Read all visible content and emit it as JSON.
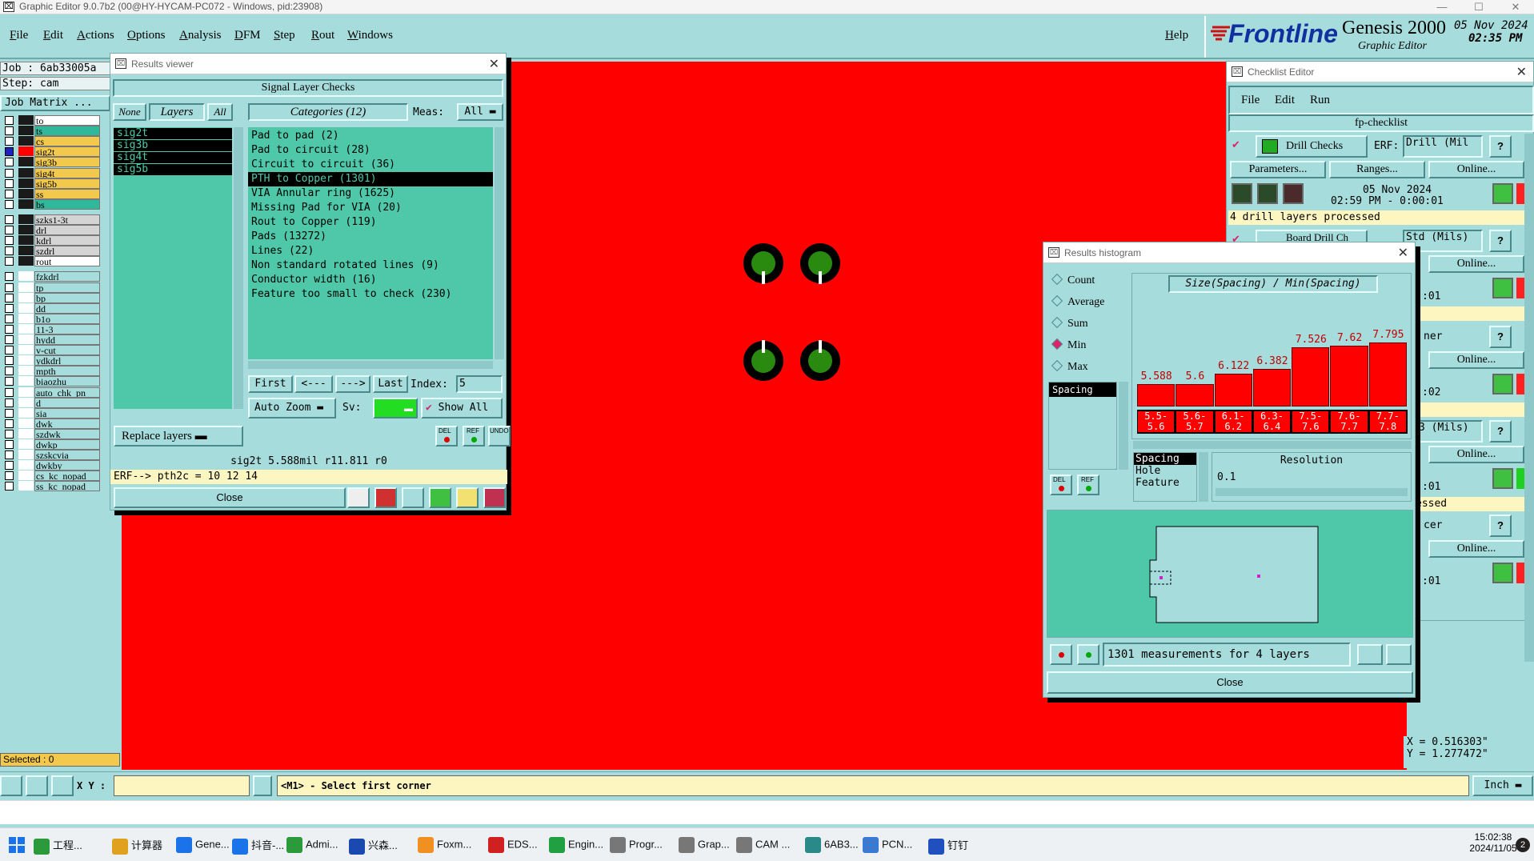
{
  "window": {
    "title": "Graphic Editor 9.0.7b2 (00@HY-HYCAM-PC072 - Windows, pid:23908)"
  },
  "menubar": {
    "items": [
      "File",
      "Edit",
      "Actions",
      "Options",
      "Analysis",
      "DFM",
      "Step",
      "Rout",
      "Windows"
    ],
    "help": "Help"
  },
  "brand": {
    "logo": "Frontline",
    "product": "Genesis 2000",
    "subtitle": "Graphic Editor",
    "date": "05 Nov 2024",
    "time": "02:35 PM"
  },
  "left_panel": {
    "job": "Job : 6ab33005a",
    "step": "Step: cam",
    "matrix_button": "Job Matrix ...",
    "layers": [
      {
        "name": "to",
        "color": "#ffffff"
      },
      {
        "name": "ts",
        "color": "#2fb89a"
      },
      {
        "name": "cs",
        "color": "#f2c94c"
      },
      {
        "name": "sig2t",
        "color": "#f2c94c",
        "active": true
      },
      {
        "name": "sig3b",
        "color": "#f2c94c"
      },
      {
        "name": "sig4t",
        "color": "#f2c94c"
      },
      {
        "name": "sig5b",
        "color": "#f2c94c"
      },
      {
        "name": "ss",
        "color": "#f2c94c"
      },
      {
        "name": "bs",
        "color": "#2fb89a"
      },
      {
        "name": "szks1-3t",
        "color": "#d4d4d4"
      },
      {
        "name": "drl",
        "color": "#d4d4d4"
      },
      {
        "name": "kdrl",
        "color": "#d4d4d4"
      },
      {
        "name": "szdrl",
        "color": "#d4d4d4"
      },
      {
        "name": "rout",
        "color": "#ffffff"
      },
      {
        "name": "fzkdrl",
        "color": "#a6dcdc"
      },
      {
        "name": "tp",
        "color": "#a6dcdc"
      },
      {
        "name": "bp",
        "color": "#a6dcdc"
      },
      {
        "name": "dd",
        "color": "#a6dcdc"
      },
      {
        "name": "b1o",
        "color": "#a6dcdc"
      },
      {
        "name": "11-3",
        "color": "#a6dcdc"
      },
      {
        "name": "hydd",
        "color": "#a6dcdc"
      },
      {
        "name": "v-cut",
        "color": "#a6dcdc"
      },
      {
        "name": "ydkdrl",
        "color": "#a6dcdc"
      },
      {
        "name": "mpth",
        "color": "#a6dcdc"
      },
      {
        "name": "biaozhu",
        "color": "#a6dcdc"
      },
      {
        "name": "auto_chk_pn",
        "color": "#a6dcdc"
      },
      {
        "name": "d",
        "color": "#a6dcdc"
      },
      {
        "name": "sia",
        "color": "#a6dcdc"
      },
      {
        "name": "dwk",
        "color": "#a6dcdc"
      },
      {
        "name": "szdwk",
        "color": "#a6dcdc"
      },
      {
        "name": "dwkp",
        "color": "#a6dcdc"
      },
      {
        "name": "szskcvia",
        "color": "#a6dcdc"
      },
      {
        "name": "dwkby",
        "color": "#a6dcdc"
      },
      {
        "name": "cs_kc_nopad",
        "color": "#a6dcdc"
      },
      {
        "name": "ss_kc_nopad",
        "color": "#a6dcdc"
      }
    ],
    "selected": "Selected : 0"
  },
  "results_viewer": {
    "title": "Results viewer",
    "header": "Signal Layer Checks",
    "none_btn": "None",
    "layers_label": "Layers",
    "all_btn": "All",
    "categories_label": "Categories (12)",
    "meas_label": "Meas:",
    "meas_value": "All",
    "layers": [
      "sig2t",
      "sig3b",
      "sig4t",
      "sig5b"
    ],
    "categories": [
      "Pad to pad (2)",
      "Pad to circuit (28)",
      "Circuit to circuit (36)",
      "PTH to Copper (1301)",
      "VIA Annular ring (1625)",
      "Missing Pad for VIA (20)",
      "Rout to Copper (119)",
      "Pads (13272)",
      "Lines (22)",
      "Non standard rotated lines (9)",
      "Conductor width (16)",
      "Feature too small to check (230)"
    ],
    "selected_category": 3,
    "first_btn": "First",
    "prev_btn": "<---",
    "next_btn": "--->",
    "last_btn": "Last",
    "index_label": "Index:",
    "index_value": "5",
    "replace_btn": "Replace layers",
    "autozoom_btn": "Auto Zoom",
    "sv_label": "Sv:",
    "showall_label": "Show All",
    "del_label": "DEL",
    "ref_label": "REF",
    "undo_label": "UNDO",
    "info_line": "sig2t 5.588mil  r11.811  r0",
    "erf_line": "ERF--> pth2c = 10 12 14",
    "close_btn": "Close"
  },
  "checklist_editor": {
    "title": "Checklist Editor",
    "menu": [
      "File",
      "Edit",
      "Run"
    ],
    "checklist_name": "fp-checklist",
    "checks": [
      {
        "name": "Drill Checks",
        "erf_label": "ERF:",
        "erf_value": "Drill (Mil",
        "params_btn": "Parameters...",
        "ranges_btn": "Ranges...",
        "online_btn": "Online...",
        "date": "05 Nov 2024",
        "time": "02:59 PM - 0:00:01",
        "status": "4 drill layers processed"
      },
      {
        "name": "Board Drill Ch",
        "erf_value": "Std (Mils)",
        "online_btn": "Online...",
        "time_frag": ":01"
      },
      {
        "name_frag": "ner",
        "online_btn": "Online...",
        "time_frag": ":02"
      },
      {
        "erf_value": "3 (Mils)",
        "online_btn": "Online...",
        "time_frag": ":01",
        "status": "essed"
      },
      {
        "name_frag": "cer",
        "online_btn": "Online...",
        "time_frag": ":01"
      }
    ]
  },
  "histogram": {
    "title": "Results histogram",
    "modes": [
      "Count",
      "Average",
      "Sum",
      "Min",
      "Max"
    ],
    "selected_mode": "Min",
    "list_left": [
      "Spacing"
    ],
    "chart_title": "Size(Spacing) / Min(Spacing)",
    "value_list": [
      "Spacing",
      "Hole",
      "Feature"
    ],
    "resolution_label": "Resolution",
    "resolution_value": "0.1",
    "measurements": "1301 measurements for 4 layers",
    "del_label": "DEL",
    "ref_label": "REF",
    "close_btn": "Close",
    "chart_data": {
      "type": "bar",
      "title": "Size(Spacing) / Min(Spacing)",
      "categories": [
        "5.5-5.6",
        "5.6-5.7",
        "6.1-6.2",
        "6.3-6.4",
        "7.5-7.6",
        "7.6-7.7",
        "7.7-7.8"
      ],
      "bin_labels_top": [
        "5.5-",
        "5.6-",
        "6.1-",
        "6.3-",
        "7.5-",
        "7.6-",
        "7.7-"
      ],
      "bin_labels_bottom": [
        "5.6",
        "5.7",
        "6.2",
        "6.4",
        "7.6",
        "7.7",
        "7.8"
      ],
      "values": [
        5.588,
        5.6,
        6.122,
        6.382,
        7.526,
        7.62,
        7.795
      ],
      "value_labels": [
        "5.588",
        "5.6",
        "6.122",
        "6.382",
        "7.526",
        "7.62",
        "7.795"
      ],
      "ylim": [
        0,
        7.795
      ]
    }
  },
  "coords": {
    "x": "X = 0.516303\"",
    "y": "Y = 1.277472\""
  },
  "statusbar": {
    "xy_label": "X Y :",
    "prompt": "<M1> - Select first corner",
    "units": "Inch"
  },
  "taskbar": {
    "apps": [
      "工程...",
      "计算器",
      "Gene...",
      "抖音-...",
      "Admi...",
      "兴森...",
      "Foxm...",
      "EDS...",
      "Engin...",
      "Progr...",
      "Grap...",
      "CAM ...",
      "6AB3...",
      "PCN...",
      "钉钉"
    ],
    "clock_time": "15:02:38",
    "clock_date": "2024/11/05",
    "notif": "2"
  },
  "colors": {
    "panel": "#a6dcdc",
    "canvas": "#ff0000",
    "list_bg": "#4ec8a8",
    "pad_green": "#2a8a10"
  }
}
